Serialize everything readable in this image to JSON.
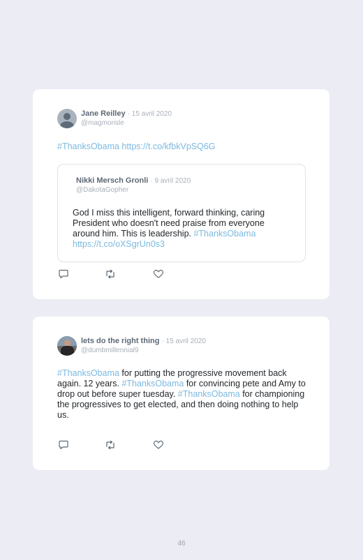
{
  "tweets": [
    {
      "author_name": "Jane Reilley",
      "date": "· 15 avril 2020",
      "handle": "@magmorisle",
      "text_parts": [
        "#ThanksObama",
        " ",
        "https://t.co/kfbkVpSQ6G"
      ],
      "quoted": {
        "author_name": "Nikki Mersch Gronli",
        "date": "· 9 avril 2020",
        "handle": "@DakotaGopher",
        "text_lines": [
          "God I miss this intelligent, forward thinking, caring",
          "President who doesn't need praise from everyone",
          "around him. This is leadership. ",
          "#ThanksObama",
          "https://t.co/oXSgrUn0s3"
        ]
      }
    },
    {
      "author_name": "lets do the right thing",
      "date": "· 15 avril 2020",
      "handle": "@dumbmillennial9",
      "text_parts": [
        "#ThanksObama",
        " for putting the progressive movement back again. 12 years. ",
        "#ThanksObama",
        " for convincing pete and Amy to drop out before super tuesday. ",
        "#ThanksObama",
        " for championing the progressives to get elected, and then doing nothing to help us."
      ]
    }
  ],
  "icons": {
    "reply": "reply-icon",
    "retweet": "retweet-icon",
    "like": "heart-icon"
  },
  "colors": {
    "background": "#ebecf4",
    "card": "#ffffff",
    "link": "#7cb9e0",
    "name": "#5d6874",
    "muted": "#a9b0b8"
  },
  "page_number": "46"
}
